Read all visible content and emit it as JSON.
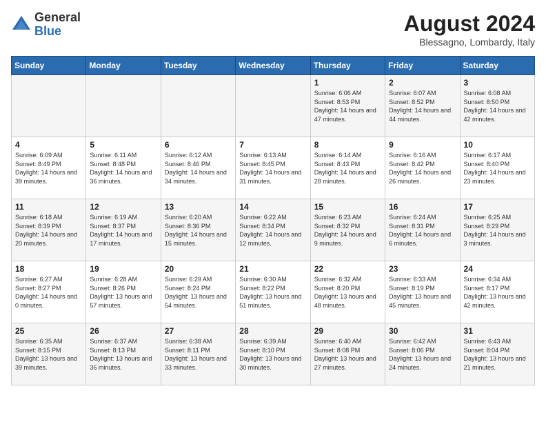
{
  "header": {
    "logo_general": "General",
    "logo_blue": "Blue",
    "month_year": "August 2024",
    "location": "Blessagno, Lombardy, Italy"
  },
  "weekdays": [
    "Sunday",
    "Monday",
    "Tuesday",
    "Wednesday",
    "Thursday",
    "Friday",
    "Saturday"
  ],
  "weeks": [
    [
      {
        "day": "",
        "info": ""
      },
      {
        "day": "",
        "info": ""
      },
      {
        "day": "",
        "info": ""
      },
      {
        "day": "",
        "info": ""
      },
      {
        "day": "1",
        "info": "Sunrise: 6:06 AM\nSunset: 8:53 PM\nDaylight: 14 hours\nand 47 minutes."
      },
      {
        "day": "2",
        "info": "Sunrise: 6:07 AM\nSunset: 8:52 PM\nDaylight: 14 hours\nand 44 minutes."
      },
      {
        "day": "3",
        "info": "Sunrise: 6:08 AM\nSunset: 8:50 PM\nDaylight: 14 hours\nand 42 minutes."
      }
    ],
    [
      {
        "day": "4",
        "info": "Sunrise: 6:09 AM\nSunset: 8:49 PM\nDaylight: 14 hours\nand 39 minutes."
      },
      {
        "day": "5",
        "info": "Sunrise: 6:11 AM\nSunset: 8:48 PM\nDaylight: 14 hours\nand 36 minutes."
      },
      {
        "day": "6",
        "info": "Sunrise: 6:12 AM\nSunset: 8:46 PM\nDaylight: 14 hours\nand 34 minutes."
      },
      {
        "day": "7",
        "info": "Sunrise: 6:13 AM\nSunset: 8:45 PM\nDaylight: 14 hours\nand 31 minutes."
      },
      {
        "day": "8",
        "info": "Sunrise: 6:14 AM\nSunset: 8:43 PM\nDaylight: 14 hours\nand 28 minutes."
      },
      {
        "day": "9",
        "info": "Sunrise: 6:16 AM\nSunset: 8:42 PM\nDaylight: 14 hours\nand 26 minutes."
      },
      {
        "day": "10",
        "info": "Sunrise: 6:17 AM\nSunset: 8:40 PM\nDaylight: 14 hours\nand 23 minutes."
      }
    ],
    [
      {
        "day": "11",
        "info": "Sunrise: 6:18 AM\nSunset: 8:39 PM\nDaylight: 14 hours\nand 20 minutes."
      },
      {
        "day": "12",
        "info": "Sunrise: 6:19 AM\nSunset: 8:37 PM\nDaylight: 14 hours\nand 17 minutes."
      },
      {
        "day": "13",
        "info": "Sunrise: 6:20 AM\nSunset: 8:36 PM\nDaylight: 14 hours\nand 15 minutes."
      },
      {
        "day": "14",
        "info": "Sunrise: 6:22 AM\nSunset: 8:34 PM\nDaylight: 14 hours\nand 12 minutes."
      },
      {
        "day": "15",
        "info": "Sunrise: 6:23 AM\nSunset: 8:32 PM\nDaylight: 14 hours\nand 9 minutes."
      },
      {
        "day": "16",
        "info": "Sunrise: 6:24 AM\nSunset: 8:31 PM\nDaylight: 14 hours\nand 6 minutes."
      },
      {
        "day": "17",
        "info": "Sunrise: 6:25 AM\nSunset: 8:29 PM\nDaylight: 14 hours\nand 3 minutes."
      }
    ],
    [
      {
        "day": "18",
        "info": "Sunrise: 6:27 AM\nSunset: 8:27 PM\nDaylight: 14 hours\nand 0 minutes."
      },
      {
        "day": "19",
        "info": "Sunrise: 6:28 AM\nSunset: 8:26 PM\nDaylight: 13 hours\nand 57 minutes."
      },
      {
        "day": "20",
        "info": "Sunrise: 6:29 AM\nSunset: 8:24 PM\nDaylight: 13 hours\nand 54 minutes."
      },
      {
        "day": "21",
        "info": "Sunrise: 6:30 AM\nSunset: 8:22 PM\nDaylight: 13 hours\nand 51 minutes."
      },
      {
        "day": "22",
        "info": "Sunrise: 6:32 AM\nSunset: 8:20 PM\nDaylight: 13 hours\nand 48 minutes."
      },
      {
        "day": "23",
        "info": "Sunrise: 6:33 AM\nSunset: 8:19 PM\nDaylight: 13 hours\nand 45 minutes."
      },
      {
        "day": "24",
        "info": "Sunrise: 6:34 AM\nSunset: 8:17 PM\nDaylight: 13 hours\nand 42 minutes."
      }
    ],
    [
      {
        "day": "25",
        "info": "Sunrise: 6:35 AM\nSunset: 8:15 PM\nDaylight: 13 hours\nand 39 minutes."
      },
      {
        "day": "26",
        "info": "Sunrise: 6:37 AM\nSunset: 8:13 PM\nDaylight: 13 hours\nand 36 minutes."
      },
      {
        "day": "27",
        "info": "Sunrise: 6:38 AM\nSunset: 8:11 PM\nDaylight: 13 hours\nand 33 minutes."
      },
      {
        "day": "28",
        "info": "Sunrise: 6:39 AM\nSunset: 8:10 PM\nDaylight: 13 hours\nand 30 minutes."
      },
      {
        "day": "29",
        "info": "Sunrise: 6:40 AM\nSunset: 8:08 PM\nDaylight: 13 hours\nand 27 minutes."
      },
      {
        "day": "30",
        "info": "Sunrise: 6:42 AM\nSunset: 8:06 PM\nDaylight: 13 hours\nand 24 minutes."
      },
      {
        "day": "31",
        "info": "Sunrise: 6:43 AM\nSunset: 8:04 PM\nDaylight: 13 hours\nand 21 minutes."
      }
    ]
  ]
}
